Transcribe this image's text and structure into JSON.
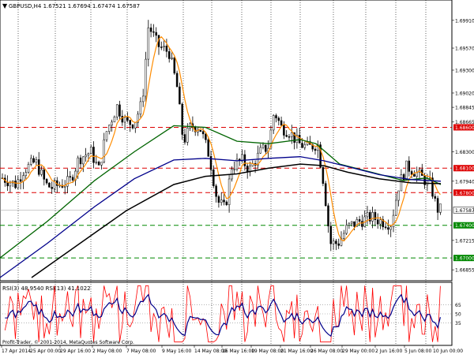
{
  "header": {
    "symbol_line": "GBPUSD,H4  1.67521 1.67694 1.67474 1.67587"
  },
  "price_axis": {
    "min": 1.6676,
    "max": 1.7014,
    "ticks": [
      "1.69910",
      "1.69570",
      "1.69300",
      "1.69020",
      "1.68845",
      "1.68665",
      "1.68300",
      "1.67940",
      "1.67215",
      "1.66855"
    ]
  },
  "current_price": "1.67587",
  "levels": [
    {
      "price": 1.686,
      "label": "1.68600",
      "color": "#dd0000"
    },
    {
      "price": 1.681,
      "label": "1.68100",
      "color": "#dd0000"
    },
    {
      "price": 1.678,
      "label": "1.67800",
      "color": "#dd0000"
    },
    {
      "price": 1.674,
      "label": "1.67400",
      "color": "#008800"
    },
    {
      "price": 1.67,
      "label": "1.67000",
      "color": "#008800"
    }
  ],
  "time_axis": {
    "labels": [
      "17 Apr 2014",
      "25 Apr 00:00",
      "29 Apr 16:00",
      "2 May 08:00",
      "7 May 08:00",
      "9 May 16:00",
      "14 May 08:00",
      "16 May 16:00",
      "19 May 08:00",
      "21 May 16:00",
      "26 May 08:00",
      "29 May 00:00",
      "2 Jun 16:00",
      "5 Jun 08:00",
      "10 Jun 00:00"
    ]
  },
  "rsi_panel": {
    "title": "RSI(3) 48.9540  RSI(13) 41.1022",
    "levels": [
      "65",
      "50",
      "35"
    ]
  },
  "copyright": "Profit-Trader, © 2001-2014, MetaQuotes Software Corp.",
  "colors": {
    "candles": "#000000",
    "ma_orange": "#ff8c00",
    "ma_green": "#006400",
    "ma_blue": "#00008b",
    "ma_black": "#000000",
    "rsi_fast": "#ff0000",
    "rsi_slow": "#00008b",
    "resistance": "#dd0000",
    "support": "#008800"
  }
}
